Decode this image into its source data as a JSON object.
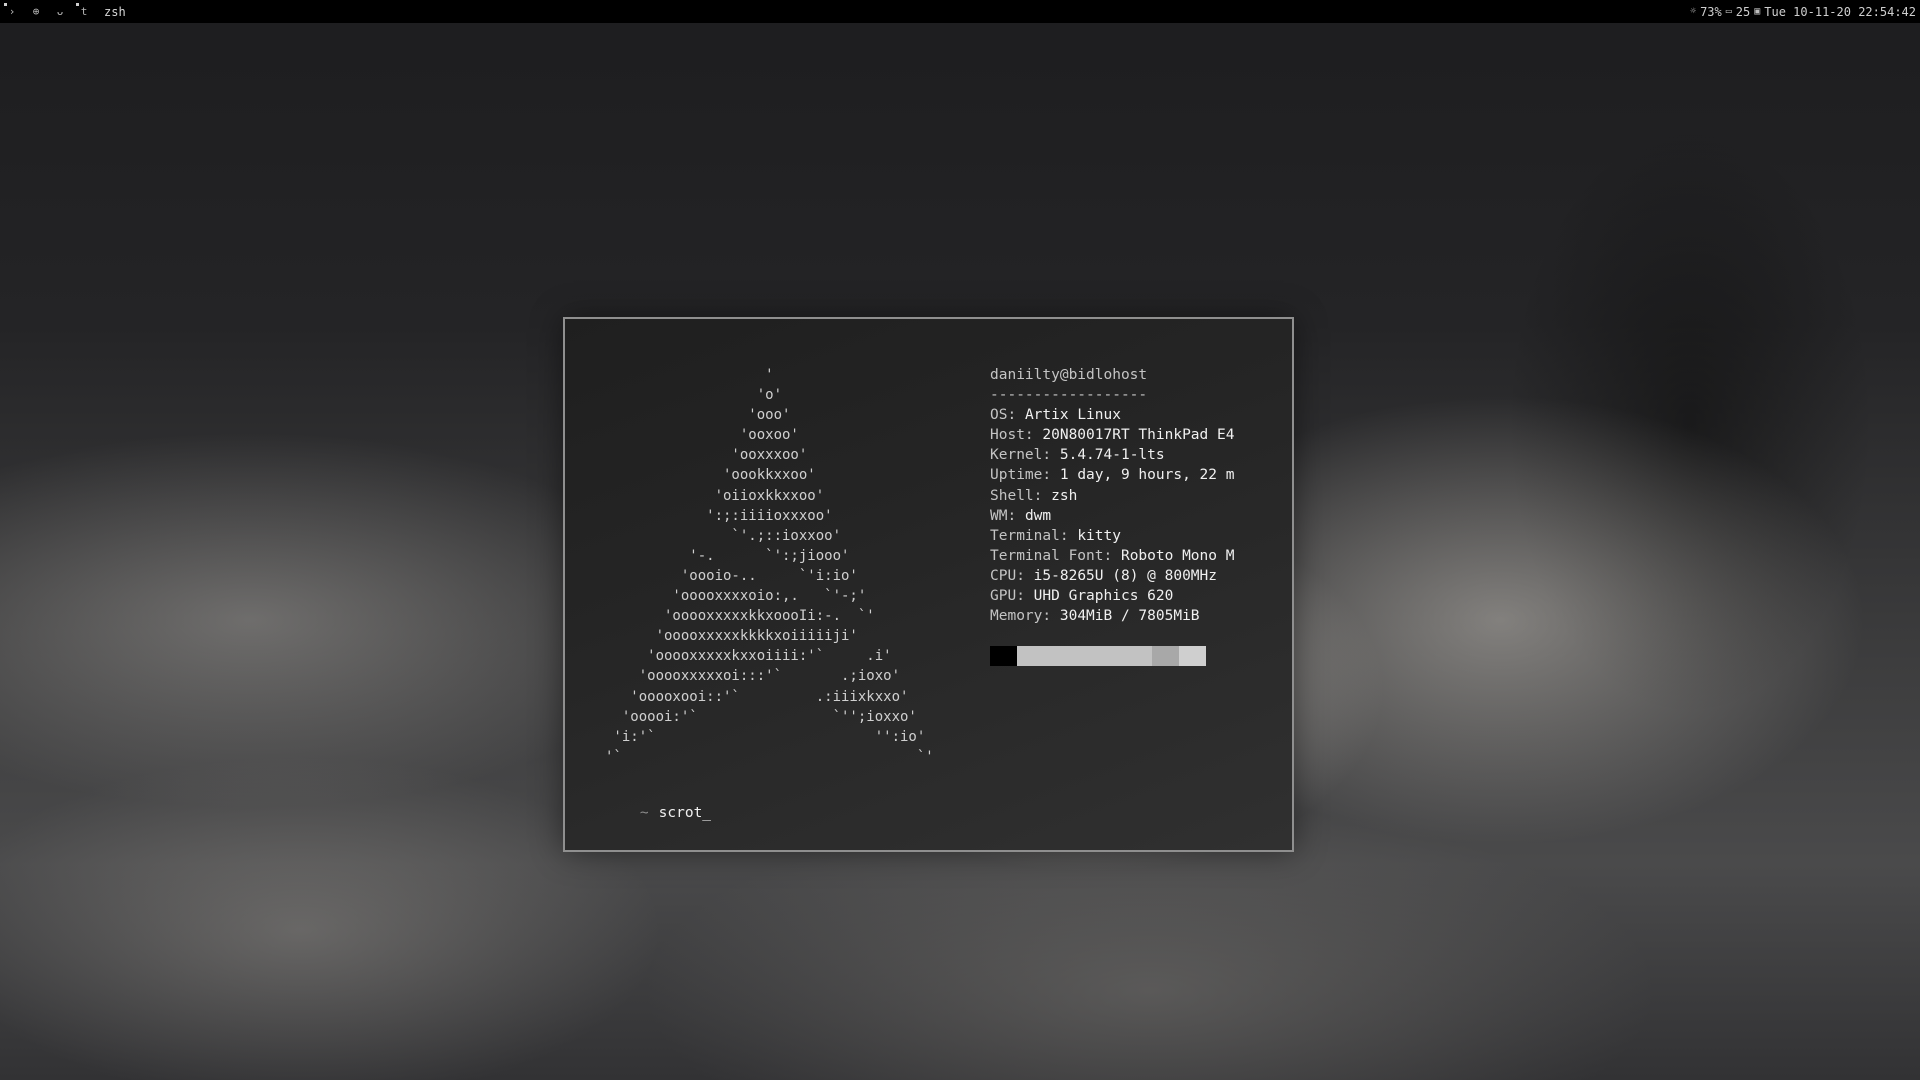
{
  "topbar": {
    "tags": [
      {
        "icon": "terminal-icon",
        "glyph": "›",
        "active": true
      },
      {
        "icon": "globe-icon",
        "glyph": "⊕",
        "active": false
      },
      {
        "icon": "cat-icon",
        "glyph": "ᴗ",
        "active": false
      },
      {
        "icon": "text-icon",
        "glyph": "t",
        "active": true
      }
    ],
    "window_title": "zsh",
    "status": {
      "brightness_icon": "brightness-icon",
      "brightness_glyph": "☼",
      "brightness": "73%",
      "battery_icon": "battery-icon",
      "battery_glyph": "▭",
      "battery": "25",
      "calendar_icon": "calendar-icon",
      "calendar_glyph": "▣",
      "datetime": "Tue 10-11-20 22:54:42"
    }
  },
  "terminal": {
    "ascii_logo": "                   '\n                  'o'\n                 'ooo'\n                'ooxoo'\n               'ooxxxoo'\n              'oookkxxoo'\n             'oiioxkkxxoo'\n            ':;:iiiioxxxoo'\n               `'.;::ioxxoo'\n          '-.      `':;jiooo'\n         'oooio-..     `'i:io'\n        'ooooxxxxoio:,.   `'-;'\n       'ooooxxxxxkkxoooIi:-.  `'\n      'ooooxxxxxkkkkxoiiiiiji'\n     'ooooxxxxxkxxoiiii:'`     .i'\n    'ooooxxxxxoi:::'`       .;ioxo'\n   'ooooxooi::'`         .:iiixkxxo'\n  'ooooi:'`                `'';ioxxo'\n 'i:'`                          '':io'\n'`                                   `'",
    "info_header": "daniilty@bidlohost",
    "separator": "------------------",
    "info": [
      {
        "key": "OS",
        "value": "Artix Linux"
      },
      {
        "key": "Host",
        "value": "20N80017RT ThinkPad E4"
      },
      {
        "key": "Kernel",
        "value": "5.4.74-1-lts"
      },
      {
        "key": "Uptime",
        "value": "1 day, 9 hours, 22 m"
      },
      {
        "key": "Shell",
        "value": "zsh"
      },
      {
        "key": "WM",
        "value": "dwm"
      },
      {
        "key": "Terminal",
        "value": "kitty"
      },
      {
        "key": "Terminal Font",
        "value": "Roboto Mono M"
      },
      {
        "key": "CPU",
        "value": "i5-8265U (8) @ 800MHz"
      },
      {
        "key": "GPU",
        "value": "UHD Graphics 620"
      },
      {
        "key": "Memory",
        "value": "304MiB / 7805MiB"
      }
    ],
    "color_blocks": [
      "#000000",
      "#c2c2c2",
      "#c2c2c2",
      "#c2c2c2",
      "#c2c2c2",
      "#c2c2c2",
      "#a8a8a8",
      "#cfcfcf"
    ],
    "prompt_symbol": "~",
    "command": "scrot_"
  }
}
